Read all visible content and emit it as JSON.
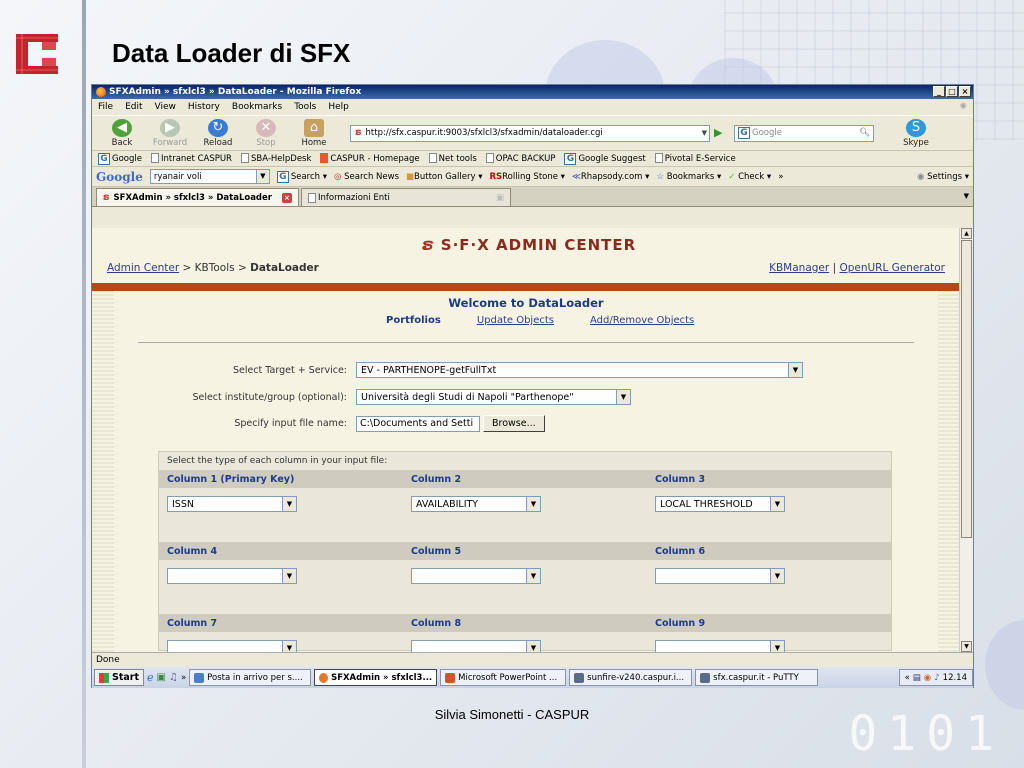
{
  "slide": {
    "title": "Data Loader di SFX",
    "footer": "Silvia Simonetti - CASPUR",
    "bg_digits": "0101"
  },
  "window": {
    "title": "SFXAdmin » sfxlcl3 » DataLoader - Mozilla Firefox",
    "menu": [
      "File",
      "Edit",
      "View",
      "History",
      "Bookmarks",
      "Tools",
      "Help"
    ],
    "nav": {
      "back": "Back",
      "forward": "Forward",
      "reload": "Reload",
      "stop": "Stop",
      "home": "Home",
      "url": "http://sfx.caspur.it:9003/sfxlcl3/sfxadmin/dataloader.cgi",
      "search_placeholder": "Google",
      "skype": "Skype"
    },
    "bookmarks": [
      "Google",
      "Intranet CASPUR",
      "SBA-HelpDesk",
      "CASPUR - Homepage",
      "Net tools",
      "OPAC BACKUP",
      "Google Suggest",
      "Pivotal E-Service"
    ],
    "google_toolbar": {
      "logo": "Google",
      "query": "ryanair voli",
      "items": [
        "Search",
        "Search News",
        "Button Gallery",
        "Rolling Stone",
        "Rhapsody.com",
        "Bookmarks",
        "Check",
        "»"
      ],
      "settings": "Settings"
    },
    "tabs": [
      {
        "label": "SFXAdmin » sfxlcl3 » DataLoader",
        "active": true
      },
      {
        "label": "Informazioni Enti",
        "active": false
      }
    ],
    "status": "Done"
  },
  "page": {
    "logo_text": "S·F·X ADMIN CENTER",
    "breadcrumb": {
      "admin_center": "Admin Center",
      "sep1": ">",
      "kbtools": "KBTools",
      "sep2": ">",
      "current": "DataLoader"
    },
    "top_links": [
      "KBManager",
      "OpenURL Generator"
    ],
    "welcome": "Welcome to DataLoader",
    "tabs": {
      "portfolios": "Portfolios",
      "update_objects": "Update Objects",
      "add_remove": "Add/Remove Objects"
    },
    "form": {
      "target_label": "Select Target + Service:",
      "target_value": "EV - PARTHENOPE-getFullTxt",
      "institute_label": "Select institute/group (optional):",
      "institute_value": "Università degli Studi di Napoli \"Parthenope\"",
      "file_label": "Specify input file name:",
      "file_value": "C:\\Documents and Setti",
      "browse": "Browse..."
    },
    "columns_box": {
      "header": "Select the type of each column in your input file:",
      "rows": [
        [
          {
            "label": "Column 1 (Primary Key)",
            "value": "ISSN"
          },
          {
            "label": "Column 2",
            "value": "AVAILABILITY"
          },
          {
            "label": "Column 3",
            "value": "LOCAL THRESHOLD"
          }
        ],
        [
          {
            "label": "Column 4",
            "value": ""
          },
          {
            "label": "Column 5",
            "value": ""
          },
          {
            "label": "Column 6",
            "value": ""
          }
        ],
        [
          {
            "label": "Column 7",
            "value": ""
          },
          {
            "label": "Column 8",
            "value": ""
          },
          {
            "label": "Column 9",
            "value": ""
          }
        ]
      ]
    }
  },
  "taskbar": {
    "start": "Start",
    "items": [
      {
        "label": "Posta in arrivo per s....",
        "active": false
      },
      {
        "label": "SFXAdmin » sfxlcl3...",
        "active": true
      },
      {
        "label": "Microsoft PowerPoint ...",
        "active": false
      },
      {
        "label": "sunfire-v240.caspur.i...",
        "active": false
      },
      {
        "label": "sfx.caspur.it - PuTTY",
        "active": false
      }
    ],
    "clock": "12.14",
    "chevron": "»",
    "tray_chevron": "«"
  }
}
